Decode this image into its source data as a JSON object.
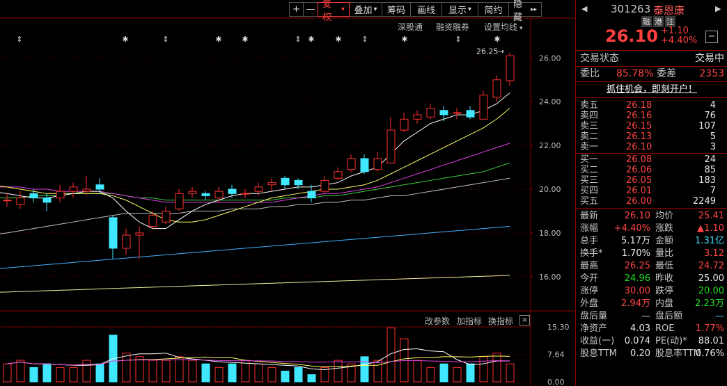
{
  "toolbar": {
    "plus": "+",
    "minus": "—",
    "fuquan": "复权",
    "fuquan_arrow": "▾",
    "diejia": "叠加",
    "diejia_arrow": "▾",
    "chouma": "筹码",
    "huaxian": "画线",
    "xianshi": "显示",
    "xianshi_arrow": "▾",
    "jianyue": "简约",
    "yincang": "隐藏",
    "yincang_arrow": "▸▸"
  },
  "subbar": {
    "shengutong": "深股通",
    "rongzi": "融资融券",
    "shezhi": "设置均线",
    "shezhi_arrow": "▾"
  },
  "high_label": "26.25",
  "high_arrow": "→",
  "y_ticks": [
    "26.00",
    "24.00",
    "22.00",
    "20.00",
    "18.00",
    "16.00"
  ],
  "vol_ticks": [
    "15.30",
    "7.64",
    "0.00"
  ],
  "indicator_bar": {
    "gaicanshu": "改参数",
    "jiazhibiao": "加指标",
    "huanzhibiao": "换指标",
    "close": "×"
  },
  "markers": [
    {
      "x": 28,
      "s": "⇕"
    },
    {
      "x": 180,
      "s": "✱"
    },
    {
      "x": 238,
      "s": "⇕"
    },
    {
      "x": 314,
      "s": "✱"
    },
    {
      "x": 352,
      "s": "✱"
    },
    {
      "x": 428,
      "s": "⇕"
    },
    {
      "x": 447,
      "s": "✱"
    },
    {
      "x": 486,
      "s": "✱"
    },
    {
      "x": 524,
      "s": "⇕"
    },
    {
      "x": 581,
      "s": "✱"
    },
    {
      "x": 658,
      "s": "⇕"
    },
    {
      "x": 714,
      "s": "✱"
    }
  ],
  "stock": {
    "code": "301263",
    "name": "泰恩康",
    "badges": [
      "融",
      "港",
      "注"
    ],
    "price": "26.10",
    "change": "+1.10",
    "change_pct": "+4.40%",
    "minus_btn": "−",
    "prev_arrow": "◀",
    "next_arrow": "▶"
  },
  "trade_state": {
    "label": "交易状态",
    "value": "交易中"
  },
  "weibi": {
    "label": "委比",
    "value": "85.78%",
    "label2": "委差",
    "value2": "2353"
  },
  "promo": "抓住机会，即刻开户！",
  "asks": [
    {
      "label": "卖五",
      "price": "26.18",
      "vol": "4"
    },
    {
      "label": "卖四",
      "price": "26.16",
      "vol": "76"
    },
    {
      "label": "卖三",
      "price": "26.15",
      "vol": "107"
    },
    {
      "label": "卖二",
      "price": "26.13",
      "vol": "5"
    },
    {
      "label": "卖一",
      "price": "26.10",
      "vol": "3"
    }
  ],
  "bids": [
    {
      "label": "买一",
      "price": "26.08",
      "vol": "24"
    },
    {
      "label": "买二",
      "price": "26.06",
      "vol": "85"
    },
    {
      "label": "买三",
      "price": "26.05",
      "vol": "183"
    },
    {
      "label": "买四",
      "price": "26.01",
      "vol": "7"
    },
    {
      "label": "买五",
      "price": "26.00",
      "vol": "2249"
    }
  ],
  "stats": [
    {
      "l1": "最新",
      "v1": "26.10",
      "c1": "r",
      "l2": "均价",
      "v2": "25.41",
      "c2": "r"
    },
    {
      "l1": "涨幅",
      "v1": "+4.40%",
      "c1": "r",
      "l2": "涨跌",
      "v2": "▲1.10",
      "c2": "r"
    },
    {
      "l1": "总手",
      "v1": "5.17万",
      "c1": "w",
      "l2": "金额",
      "v2": "1.31亿",
      "c2": "c"
    },
    {
      "l1": "换手*",
      "v1": "1.70%",
      "c1": "w",
      "l2": "量比",
      "v2": "3.12",
      "c2": "r"
    },
    {
      "l1": "最高",
      "v1": "26.25",
      "c1": "r",
      "l2": "最低",
      "v2": "24.72",
      "c2": "r"
    },
    {
      "l1": "今开",
      "v1": "24.96",
      "c1": "g",
      "l2": "昨收",
      "v2": "25.00",
      "c2": "w"
    },
    {
      "l1": "涨停",
      "v1": "30.00",
      "c1": "r",
      "l2": "跌停",
      "v2": "20.00",
      "c2": "g"
    },
    {
      "l1": "外盘",
      "v1": "2.94万",
      "c1": "r",
      "l2": "内盘",
      "v2": "2.23万",
      "c2": "g"
    },
    {
      "l1": "盘后量",
      "v1": "—",
      "c1": "w",
      "l2": "盘后额",
      "v2": "—",
      "c2": "c"
    },
    {
      "l1": "净资产",
      "v1": "4.03",
      "c1": "w",
      "l2": "ROE",
      "v2": "1.77%",
      "c2": "r"
    },
    {
      "l1": "收益(一)",
      "v1": "0.074",
      "c1": "w",
      "l2": "PE(动)*",
      "v2": "88.01",
      "c2": "w"
    },
    {
      "l1": "股息TTM",
      "v1": "0.20",
      "c1": "w",
      "l2": "股息率TTM",
      "v2": "0.76%",
      "c2": "w"
    }
  ],
  "colors": {
    "up": "#ff3030",
    "down": "#40e8ff",
    "ma5": "#ffffff",
    "ma10": "#ffff66",
    "ma20": "#e040e0",
    "ma30": "#40d040",
    "ma60": "#c0c0c0",
    "ma120": "#40b0ff",
    "ma250": "#f0f0a0"
  },
  "chart_data": {
    "type": "candlestick",
    "ylim": [
      14.5,
      26.9
    ],
    "candles": [
      {
        "o": 19.5,
        "c": 19.5,
        "h": 19.8,
        "l": 19.2
      },
      {
        "o": 19.3,
        "c": 19.6,
        "h": 19.9,
        "l": 19.1
      },
      {
        "o": 19.8,
        "c": 19.6,
        "h": 20.0,
        "l": 19.4
      },
      {
        "o": 19.6,
        "c": 19.4,
        "h": 19.8,
        "l": 19.0
      },
      {
        "o": 19.6,
        "c": 19.9,
        "h": 20.2,
        "l": 19.4
      },
      {
        "o": 19.9,
        "c": 20.1,
        "h": 20.3,
        "l": 19.6
      },
      {
        "o": 19.9,
        "c": 20.0,
        "h": 20.6,
        "l": 19.7
      },
      {
        "o": 20.2,
        "c": 20.0,
        "h": 20.5,
        "l": 19.8
      },
      {
        "o": 18.7,
        "c": 17.3,
        "h": 18.8,
        "l": 16.8
      },
      {
        "o": 17.3,
        "c": 17.9,
        "h": 18.2,
        "l": 17.0
      },
      {
        "o": 17.9,
        "c": 18.0,
        "h": 18.3,
        "l": 16.8
      },
      {
        "o": 18.3,
        "c": 18.8,
        "h": 19.0,
        "l": 18.2
      },
      {
        "o": 18.5,
        "c": 19.0,
        "h": 19.2,
        "l": 18.4
      },
      {
        "o": 19.1,
        "c": 19.8,
        "h": 20.0,
        "l": 19.0
      },
      {
        "o": 19.8,
        "c": 19.9,
        "h": 20.1,
        "l": 19.6
      },
      {
        "o": 19.8,
        "c": 19.7,
        "h": 19.9,
        "l": 19.5
      },
      {
        "o": 19.6,
        "c": 19.9,
        "h": 20.1,
        "l": 19.4
      },
      {
        "o": 20.0,
        "c": 19.8,
        "h": 20.2,
        "l": 19.6
      },
      {
        "o": 19.8,
        "c": 19.8,
        "h": 20.0,
        "l": 19.6
      },
      {
        "o": 19.9,
        "c": 20.1,
        "h": 20.3,
        "l": 19.7
      },
      {
        "o": 20.2,
        "c": 20.3,
        "h": 20.5,
        "l": 19.9
      },
      {
        "o": 20.5,
        "c": 20.2,
        "h": 20.6,
        "l": 20.0
      },
      {
        "o": 20.4,
        "c": 20.2,
        "h": 20.5,
        "l": 20.0
      },
      {
        "o": 19.9,
        "c": 19.6,
        "h": 20.2,
        "l": 19.4
      },
      {
        "o": 19.9,
        "c": 20.4,
        "h": 20.6,
        "l": 19.8
      },
      {
        "o": 20.5,
        "c": 20.8,
        "h": 21.0,
        "l": 20.4
      },
      {
        "o": 20.9,
        "c": 21.4,
        "h": 21.6,
        "l": 20.8
      },
      {
        "o": 21.4,
        "c": 20.8,
        "h": 21.6,
        "l": 20.7
      },
      {
        "o": 20.9,
        "c": 21.4,
        "h": 21.7,
        "l": 20.8
      },
      {
        "o": 21.2,
        "c": 22.7,
        "h": 23.3,
        "l": 21.2
      },
      {
        "o": 22.7,
        "c": 23.2,
        "h": 23.5,
        "l": 22.6
      },
      {
        "o": 23.2,
        "c": 23.4,
        "h": 23.6,
        "l": 23.0
      },
      {
        "o": 23.3,
        "c": 23.7,
        "h": 23.9,
        "l": 23.2
      },
      {
        "o": 23.6,
        "c": 23.4,
        "h": 23.8,
        "l": 23.1
      },
      {
        "o": 23.5,
        "c": 23.5,
        "h": 23.7,
        "l": 23.2
      },
      {
        "o": 23.6,
        "c": 23.3,
        "h": 23.8,
        "l": 23.2
      },
      {
        "o": 23.2,
        "c": 24.3,
        "h": 24.5,
        "l": 23.2
      },
      {
        "o": 24.2,
        "c": 25.0,
        "h": 25.2,
        "l": 24.0
      },
      {
        "o": 24.96,
        "c": 26.1,
        "h": 26.25,
        "l": 24.72
      }
    ],
    "ma": {
      "ma5": [
        19.8,
        19.7,
        19.6,
        19.6,
        19.7,
        19.8,
        19.9,
        19.9,
        19.6,
        19.0,
        18.5,
        18.2,
        18.2,
        18.6,
        19.0,
        19.3,
        19.5,
        19.7,
        19.8,
        19.8,
        19.9,
        20.0,
        20.1,
        20.1,
        20.2,
        20.3,
        20.6,
        20.8,
        21.0,
        21.6,
        22.2,
        22.6,
        23.0,
        23.2,
        23.4,
        23.4,
        23.6,
        23.9,
        24.4
      ],
      "ma10": [
        20.1,
        20.0,
        19.9,
        19.8,
        19.8,
        19.8,
        19.8,
        19.8,
        19.7,
        19.5,
        19.2,
        18.9,
        18.6,
        18.5,
        18.5,
        18.6,
        18.8,
        19.0,
        19.2,
        19.4,
        19.6,
        19.7,
        19.8,
        19.9,
        20.0,
        20.0,
        20.1,
        20.2,
        20.4,
        20.7,
        21.0,
        21.3,
        21.6,
        21.9,
        22.2,
        22.5,
        22.8,
        23.2,
        23.7
      ],
      "ma20": [
        20.1,
        20.1,
        20.0,
        20.0,
        19.9,
        19.9,
        19.9,
        19.9,
        19.8,
        19.7,
        19.6,
        19.5,
        19.4,
        19.4,
        19.4,
        19.4,
        19.4,
        19.4,
        19.4,
        19.4,
        19.4,
        19.5,
        19.6,
        19.7,
        19.8,
        19.8,
        19.9,
        20.0,
        20.1,
        20.3,
        20.5,
        20.7,
        20.9,
        21.1,
        21.3,
        21.5,
        21.7,
        21.9,
        22.1
      ],
      "ma30": [
        19.6,
        19.6,
        19.7,
        19.7,
        19.7,
        19.8,
        19.8,
        19.8,
        19.8,
        19.7,
        19.6,
        19.6,
        19.5,
        19.5,
        19.5,
        19.5,
        19.5,
        19.5,
        19.5,
        19.5,
        19.5,
        19.6,
        19.6,
        19.6,
        19.7,
        19.7,
        19.8,
        19.9,
        20.0,
        20.1,
        20.2,
        20.3,
        20.4,
        20.5,
        20.6,
        20.7,
        20.8,
        21.0,
        21.2
      ],
      "ma60": [
        18.0,
        18.1,
        18.2,
        18.3,
        18.4,
        18.5,
        18.6,
        18.7,
        18.8,
        18.9,
        18.9,
        18.9,
        18.9,
        18.9,
        19.0,
        19.0,
        19.0,
        19.1,
        19.1,
        19.1,
        19.2,
        19.2,
        19.3,
        19.3,
        19.4,
        19.4,
        19.5,
        19.5,
        19.6,
        19.7,
        19.7,
        19.8,
        19.9,
        20.0,
        20.1,
        20.2,
        20.3,
        20.4,
        20.5
      ],
      "ma120": [
        16.4,
        16.45,
        16.5,
        16.55,
        16.6,
        16.65,
        16.7,
        16.75,
        16.8,
        16.85,
        16.9,
        16.95,
        17.0,
        17.05,
        17.1,
        17.15,
        17.2,
        17.25,
        17.3,
        17.35,
        17.4,
        17.45,
        17.5,
        17.55,
        17.6,
        17.65,
        17.7,
        17.75,
        17.8,
        17.85,
        17.9,
        17.95,
        18.0,
        18.05,
        18.1,
        18.15,
        18.2,
        18.25,
        18.3
      ],
      "ma250": [
        15.3,
        15.32,
        15.34,
        15.36,
        15.38,
        15.4,
        15.42,
        15.44,
        15.46,
        15.48,
        15.5,
        15.52,
        15.54,
        15.56,
        15.58,
        15.6,
        15.62,
        15.64,
        15.66,
        15.68,
        15.7,
        15.72,
        15.74,
        15.76,
        15.78,
        15.8,
        15.82,
        15.84,
        15.86,
        15.88,
        15.9,
        15.92,
        15.94,
        15.96,
        15.98,
        16.0,
        16.02,
        16.04,
        16.06
      ]
    },
    "volume": {
      "ylim": [
        0,
        15.3
      ],
      "values": [
        5,
        6,
        4,
        5,
        4,
        4,
        6,
        5,
        13,
        8,
        7,
        6,
        6,
        7,
        6,
        5,
        4,
        5,
        6,
        5,
        4,
        3,
        4,
        2,
        4,
        6,
        5,
        7,
        6,
        15,
        12,
        6,
        4,
        5,
        4,
        5,
        7,
        8,
        5
      ]
    }
  }
}
